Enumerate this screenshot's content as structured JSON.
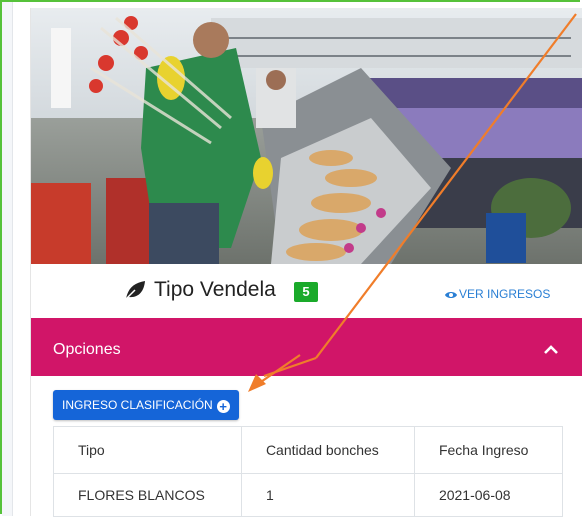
{
  "card": {
    "title": "Tipo Vendela",
    "count": "5",
    "view_link": "VER INGRESOS",
    "icon": "leaf-icon",
    "photo": "flower-packing-photo"
  },
  "panel": {
    "title": "Opciones",
    "toggle_icon": "chevron-up-icon",
    "color": "#d11568"
  },
  "actions": {
    "ingreso_label": "INGRESO CLASIFICACIÓN",
    "ingreso_icon": "plus-circle-icon",
    "color": "#1565d8"
  },
  "table": {
    "headers": [
      "Tipo",
      "Cantidad bonches",
      "Fecha Ingreso"
    ],
    "rows": [
      [
        "FLORES BLANCOS",
        "1",
        "2021-06-08"
      ]
    ]
  },
  "colors": {
    "badge": "#1aaa2a",
    "link": "#2a7fd4",
    "annotation_arrow": "#f07d2a",
    "frame": "#56c23a"
  }
}
